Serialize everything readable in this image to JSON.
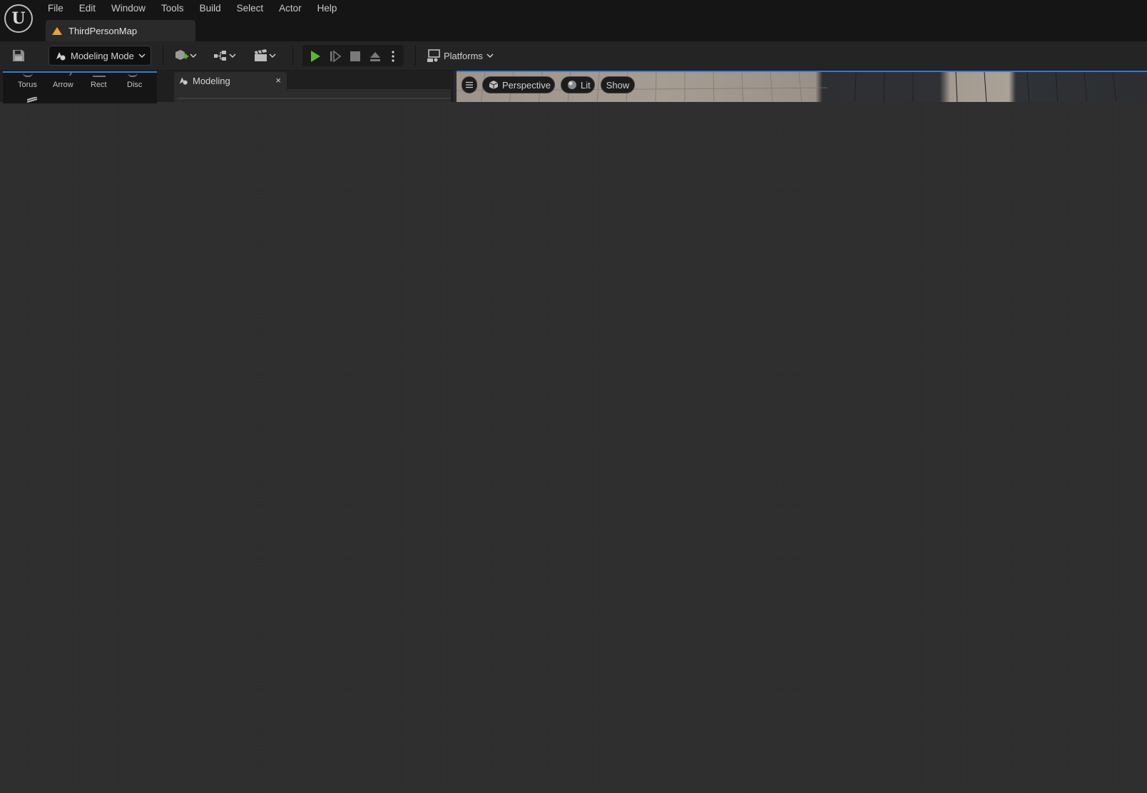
{
  "menubar": {
    "logo_letter": "U",
    "items": [
      {
        "label": "File"
      },
      {
        "label": "Edit"
      },
      {
        "label": "Window"
      },
      {
        "label": "Tools"
      },
      {
        "label": "Build"
      },
      {
        "label": "Select"
      },
      {
        "label": "Actor"
      },
      {
        "label": "Help"
      }
    ],
    "document_tab": "ThirdPersonMap",
    "accent_color": "#e8a23b"
  },
  "toolbar": {
    "mode_label": "Modeling Mode",
    "platforms_label": "Platforms",
    "play_color": "#5cb82d"
  },
  "shapes_panel": {
    "items": [
      {
        "label": "Torus"
      },
      {
        "label": "Arrow"
      },
      {
        "label": "Rect"
      },
      {
        "label": "Disc"
      }
    ]
  },
  "modeling_panel": {
    "tab_label": "Modeling",
    "close_glyph": "×"
  },
  "viewport": {
    "perspective_label": "Perspective",
    "lit_label": "Lit",
    "show_label": "Show",
    "selection_color": "#2a7de1"
  }
}
